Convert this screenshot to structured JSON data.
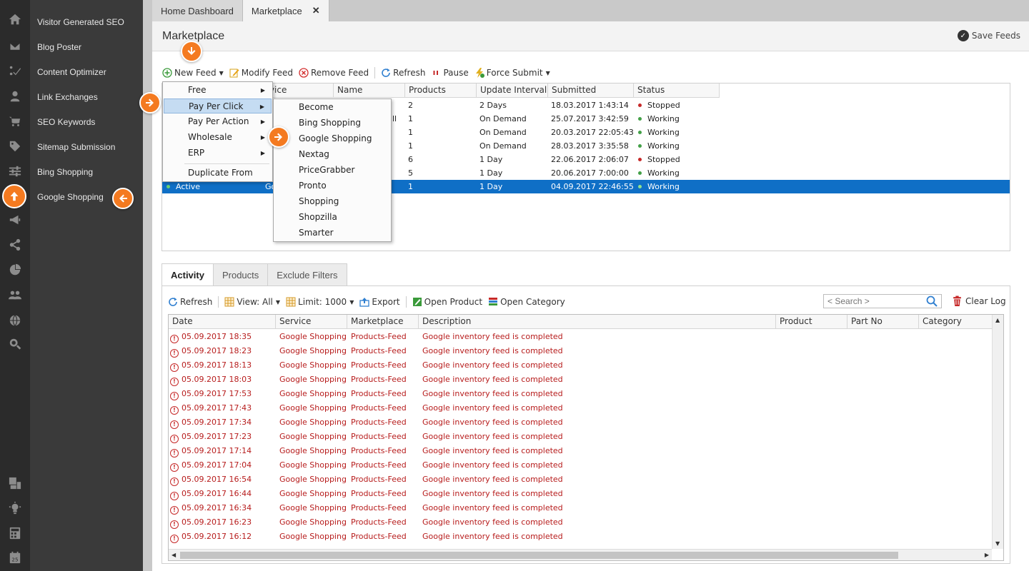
{
  "sidebar": {
    "items": [
      {
        "label": "Visitor Generated SEO"
      },
      {
        "label": "Blog Poster"
      },
      {
        "label": "Content Optimizer"
      },
      {
        "label": "Link Exchanges"
      },
      {
        "label": "SEO Keywords"
      },
      {
        "label": "Sitemap Submission"
      },
      {
        "label": "Bing Shopping"
      },
      {
        "label": "Google Shopping"
      }
    ],
    "rail_icons": [
      "home-icon",
      "mail-icon",
      "checklist-icon",
      "user-icon",
      "cart-icon",
      "tag-icon",
      "sliders-icon",
      "upload-icon",
      "megaphone-icon",
      "share-icon",
      "pie-chart-icon",
      "users-icon",
      "globe-icon",
      "search-gear-icon",
      "dashboard-icon",
      "lightbulb-icon",
      "calculator-icon",
      "calendar-icon"
    ],
    "calendar_day": "25"
  },
  "tabs": [
    {
      "label": "Home Dashboard",
      "active": false
    },
    {
      "label": "Marketplace",
      "active": true,
      "close": "✕"
    }
  ],
  "header": {
    "title": "Marketplace",
    "save_label": "Save Feeds"
  },
  "toolbar": {
    "new_feed": "New Feed",
    "modify_feed": "Modify Feed",
    "remove_feed": "Remove Feed",
    "refresh": "Refresh",
    "pause": "Pause",
    "force_submit": "Force Submit"
  },
  "feeds_grid": {
    "columns": [
      "Service",
      "Name",
      "Products",
      "Update Interval",
      "Submitted",
      "Status"
    ],
    "visible_service_header": "rvice",
    "rows": [
      {
        "name": "",
        "products": "2",
        "interval": "2 Days",
        "submitted": "18.03.2017 1:43:14",
        "status": "Stopped"
      },
      {
        "name": "ll",
        "products": "1",
        "interval": "On Demand",
        "submitted": "25.07.2017 3:42:59",
        "status": "Working"
      },
      {
        "name": "",
        "products": "1",
        "interval": "On Demand",
        "submitted": "20.03.2017 22:05:43",
        "status": "Working"
      },
      {
        "name": "",
        "products": "1",
        "interval": "On Demand",
        "submitted": "28.03.2017 3:35:58",
        "status": "Working"
      },
      {
        "name": "",
        "products": "6",
        "interval": "1 Day",
        "submitted": "22.06.2017 2:06:07",
        "status": "Stopped"
      },
      {
        "name": "",
        "products": "5",
        "interval": "1 Day",
        "submitted": "20.06.2017 7:00:00",
        "status": "Working"
      },
      {
        "active": "Active",
        "service": "Go",
        "name": "",
        "products": "1",
        "interval": "1 Day",
        "submitted": "04.09.2017 22:46:55",
        "status": "Working",
        "selected": true
      }
    ]
  },
  "new_feed_menu": {
    "items": [
      "Free",
      "Pay Per Click",
      "Pay Per Action",
      "Wholesale",
      "ERP"
    ],
    "duplicate": "Duplicate From",
    "highlighted": "Pay Per Click"
  },
  "ppc_submenu": {
    "items": [
      "Become",
      "Bing Shopping",
      "Google Shopping",
      "Nextag",
      "PriceGrabber",
      "Pronto",
      "Shopping",
      "Shopzilla",
      "Smarter"
    ]
  },
  "lower_tabs": [
    {
      "label": "Activity",
      "active": true
    },
    {
      "label": "Products",
      "active": false
    },
    {
      "label": "Exclude Filters",
      "active": false
    }
  ],
  "activity_toolbar": {
    "refresh": "Refresh",
    "view": "View: All",
    "limit": "Limit: 1000",
    "export": "Export",
    "open_product": "Open Product",
    "open_category": "Open Category",
    "search_placeholder": "< Search >",
    "clear_log": "Clear Log"
  },
  "log_grid": {
    "columns": [
      "Date",
      "Service",
      "Marketplace",
      "Description",
      "Product",
      "Part No",
      "Category"
    ],
    "rows": [
      {
        "date": "05.09.2017 18:35",
        "service": "Google Shopping",
        "marketplace": "Products-Feed",
        "description": "Google inventory feed is completed"
      },
      {
        "date": "05.09.2017 18:23",
        "service": "Google Shopping",
        "marketplace": "Products-Feed",
        "description": "Google inventory feed is completed"
      },
      {
        "date": "05.09.2017 18:13",
        "service": "Google Shopping",
        "marketplace": "Products-Feed",
        "description": "Google inventory feed is completed"
      },
      {
        "date": "05.09.2017 18:03",
        "service": "Google Shopping",
        "marketplace": "Products-Feed",
        "description": "Google inventory feed is completed"
      },
      {
        "date": "05.09.2017 17:53",
        "service": "Google Shopping",
        "marketplace": "Products-Feed",
        "description": "Google inventory feed is completed"
      },
      {
        "date": "05.09.2017 17:43",
        "service": "Google Shopping",
        "marketplace": "Products-Feed",
        "description": "Google inventory feed is completed"
      },
      {
        "date": "05.09.2017 17:34",
        "service": "Google Shopping",
        "marketplace": "Products-Feed",
        "description": "Google inventory feed is completed"
      },
      {
        "date": "05.09.2017 17:23",
        "service": "Google Shopping",
        "marketplace": "Products-Feed",
        "description": "Google inventory feed is completed"
      },
      {
        "date": "05.09.2017 17:14",
        "service": "Google Shopping",
        "marketplace": "Products-Feed",
        "description": "Google inventory feed is completed"
      },
      {
        "date": "05.09.2017 17:04",
        "service": "Google Shopping",
        "marketplace": "Products-Feed",
        "description": "Google inventory feed is completed"
      },
      {
        "date": "05.09.2017 16:54",
        "service": "Google Shopping",
        "marketplace": "Products-Feed",
        "description": "Google inventory feed is completed"
      },
      {
        "date": "05.09.2017 16:44",
        "service": "Google Shopping",
        "marketplace": "Products-Feed",
        "description": "Google inventory feed is completed"
      },
      {
        "date": "05.09.2017 16:34",
        "service": "Google Shopping",
        "marketplace": "Products-Feed",
        "description": "Google inventory feed is completed"
      },
      {
        "date": "05.09.2017 16:23",
        "service": "Google Shopping",
        "marketplace": "Products-Feed",
        "description": "Google inventory feed is completed"
      },
      {
        "date": "05.09.2017 16:12",
        "service": "Google Shopping",
        "marketplace": "Products-Feed",
        "description": "Google inventory feed is completed"
      }
    ]
  },
  "colors": {
    "accent_orange": "#f47a20",
    "selection_blue": "#0f6fc6",
    "status_stopped": "#c62828",
    "status_working": "#43a047",
    "log_text_red": "#b71c1c",
    "sidebar_bg": "#3a3a3a",
    "rail_bg": "#2b2b2b"
  }
}
